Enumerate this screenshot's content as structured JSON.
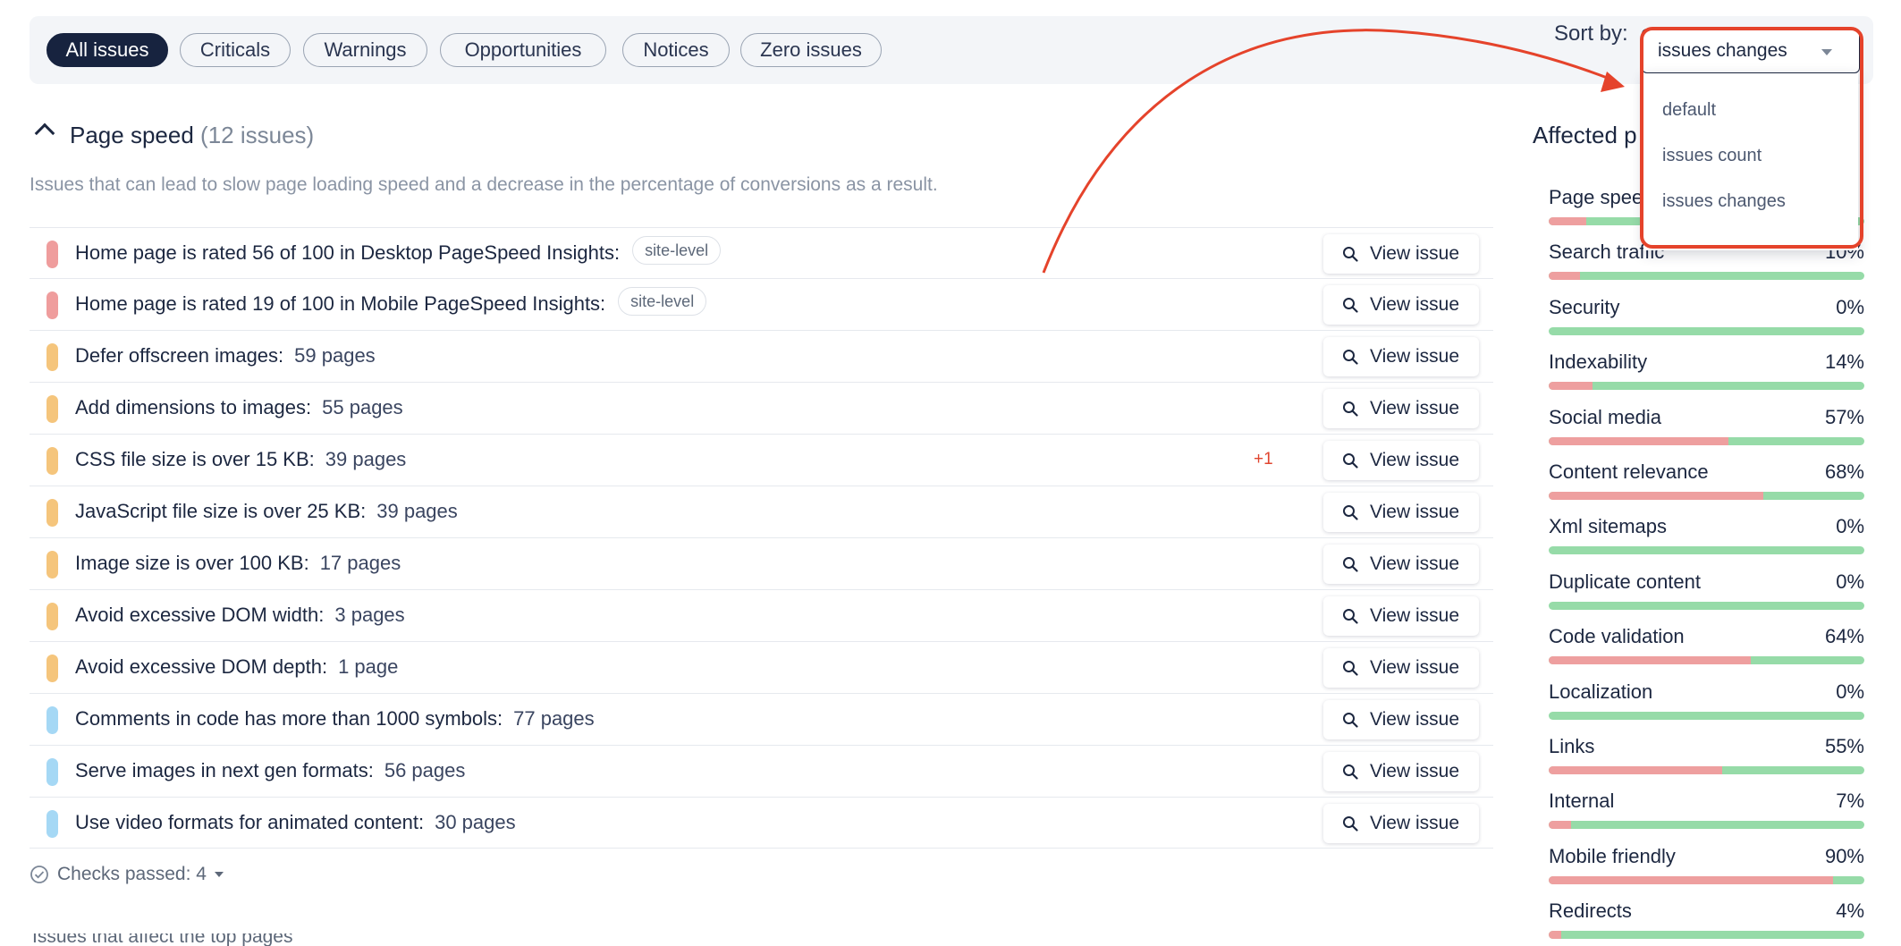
{
  "filters": {
    "all": "All issues",
    "criticals": "Criticals",
    "warnings": "Warnings",
    "opportunities": "Opportunities",
    "notices": "Notices",
    "zero": "Zero issues"
  },
  "sort": {
    "label": "Sort by:",
    "selected": "issues changes",
    "options": [
      "default",
      "issues count",
      "issues changes"
    ]
  },
  "section": {
    "title": "Page speed",
    "count": "(12 issues)",
    "description": "Issues that can lead to slow page loading speed and a decrease in the percentage of conversions as a result."
  },
  "view_label": "View issue",
  "issues": [
    {
      "text": "Home page is rated 56 of 100 in Desktop PageSpeed Insights:",
      "count": "",
      "tag": "site-level",
      "delta": "",
      "severity": "critical"
    },
    {
      "text": "Home page is rated 19 of 100 in Mobile PageSpeed Insights:",
      "count": "",
      "tag": "site-level",
      "delta": "",
      "severity": "critical"
    },
    {
      "text": "Defer offscreen images:",
      "count": "59 pages",
      "tag": "",
      "delta": "",
      "severity": "warning"
    },
    {
      "text": "Add dimensions to images:",
      "count": "55 pages",
      "tag": "",
      "delta": "",
      "severity": "warning"
    },
    {
      "text": "CSS file size is over 15 KB:",
      "count": "39 pages",
      "tag": "",
      "delta": "+1",
      "severity": "warning"
    },
    {
      "text": "JavaScript file size is over 25 KB:",
      "count": "39 pages",
      "tag": "",
      "delta": "",
      "severity": "warning"
    },
    {
      "text": "Image size is over 100 KB:",
      "count": "17 pages",
      "tag": "",
      "delta": "",
      "severity": "warning"
    },
    {
      "text": "Avoid excessive DOM width:",
      "count": "3 pages",
      "tag": "",
      "delta": "",
      "severity": "warning"
    },
    {
      "text": "Avoid excessive DOM depth:",
      "count": "1 page",
      "tag": "",
      "delta": "",
      "severity": "warning"
    },
    {
      "text": "Comments in code has more than 1000 symbols:",
      "count": "77 pages",
      "tag": "",
      "delta": "",
      "severity": "opportunity"
    },
    {
      "text": "Serve images in next gen formats:",
      "count": "56 pages",
      "tag": "",
      "delta": "",
      "severity": "opportunity"
    },
    {
      "text": "Use video formats for animated content:",
      "count": "30 pages",
      "tag": "",
      "delta": "",
      "severity": "opportunity"
    }
  ],
  "checks_passed": "Checks passed: 4",
  "partial_text": "Issues that affect the top pages",
  "panel": {
    "title": "Affected p",
    "categories": [
      {
        "label": "Page spee",
        "pct": "",
        "value": 0.12
      },
      {
        "label": "Search traffic",
        "pct": "10%",
        "value": 0.1
      },
      {
        "label": "Security",
        "pct": "0%",
        "value": 0.0
      },
      {
        "label": "Indexability",
        "pct": "14%",
        "value": 0.14
      },
      {
        "label": "Social media",
        "pct": "57%",
        "value": 0.57
      },
      {
        "label": "Content relevance",
        "pct": "68%",
        "value": 0.68
      },
      {
        "label": "Xml sitemaps",
        "pct": "0%",
        "value": 0.0
      },
      {
        "label": "Duplicate content",
        "pct": "0%",
        "value": 0.0
      },
      {
        "label": "Code validation",
        "pct": "64%",
        "value": 0.64
      },
      {
        "label": "Localization",
        "pct": "0%",
        "value": 0.0
      },
      {
        "label": "Links",
        "pct": "55%",
        "value": 0.55
      },
      {
        "label": "Internal",
        "pct": "7%",
        "value": 0.07
      },
      {
        "label": "Mobile friendly",
        "pct": "90%",
        "value": 0.9
      },
      {
        "label": "Redirects",
        "pct": "4%",
        "value": 0.04
      }
    ]
  },
  "colors": {
    "accent": "#e5432b",
    "critical": "#ef9d9d",
    "warning": "#f5c57c",
    "opportunity": "#a5d8f5",
    "bar_green": "#96dba8",
    "bar_red": "#ee9f9f"
  }
}
